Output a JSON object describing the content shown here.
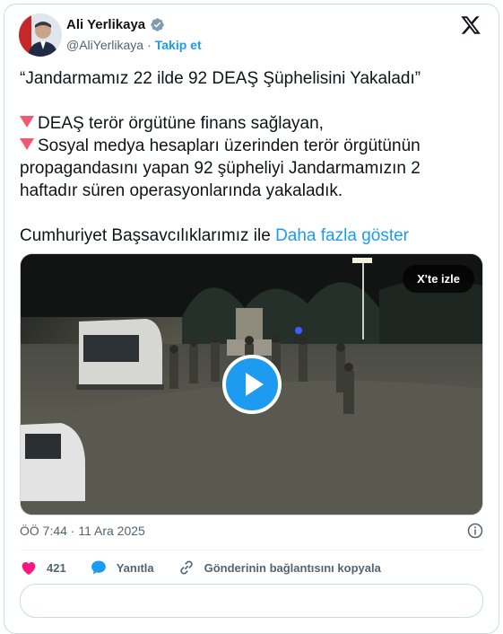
{
  "author": {
    "name": "Ali Yerlikaya",
    "handle": "@AliYerlikaya",
    "separator": "·",
    "follow_label": "Takip et"
  },
  "tweet": {
    "line1": "“Jandarmamız 22 ilde 92 DEAŞ Şüphelisini Yakaladı”",
    "bullet1": "DEAŞ terör örgütüne finans sağlayan,",
    "bullet2": "Sosyal medya hesapları üzerinden terör örgütünün propagandasını yapan 92 şüpheliyi Jandarmamızın 2 haftadır süren operasyonlarında yakaladık.",
    "line_last": "Cumhuriyet Başsavcılıklarımız ile",
    "show_more": "Daha fazla göster"
  },
  "media": {
    "watch_label": "X'te izle"
  },
  "meta": {
    "timestamp": "ÖÖ 7:44 · 11 Ara 2025"
  },
  "actions": {
    "likes": "421",
    "reply_label": "Yanıtla",
    "copy_link_label": "Gönderinin bağlantısını kopyala"
  },
  "colors": {
    "accent": "#1d9bf0",
    "like": "#f91880",
    "bullet_triangle": "#ee5a6f"
  },
  "icons": [
    "verified-badge-icon",
    "x-logo-icon",
    "play-icon",
    "info-icon",
    "heart-icon",
    "reply-bubble-icon",
    "link-icon"
  ]
}
